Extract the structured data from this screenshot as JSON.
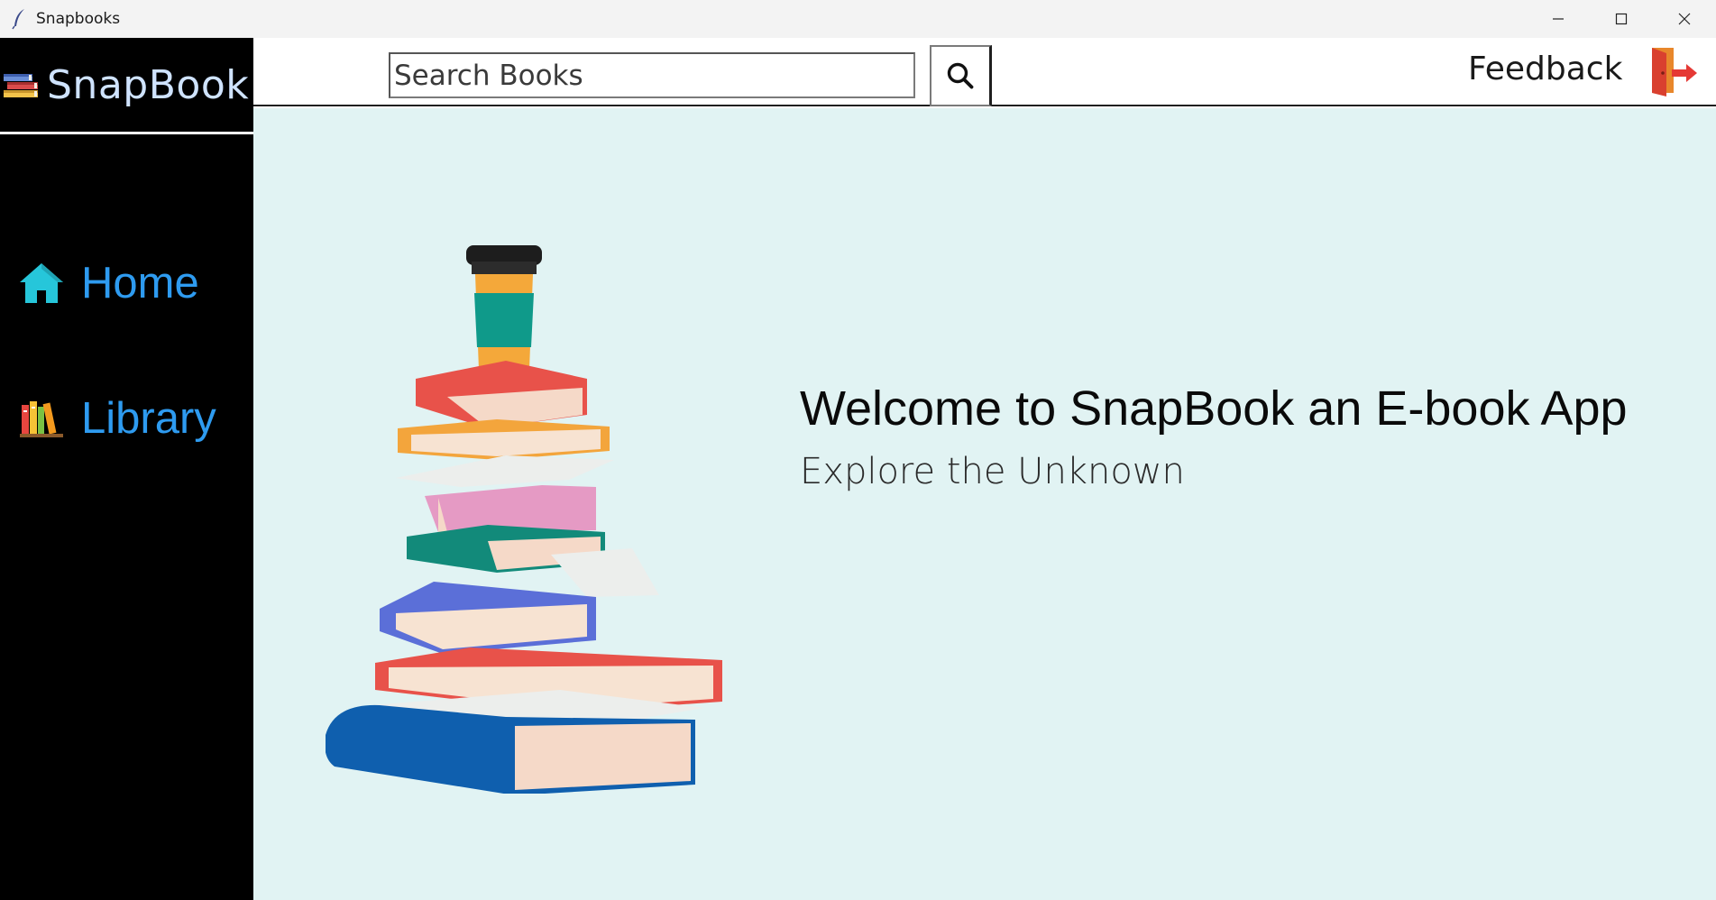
{
  "window": {
    "title": "Snapbooks",
    "app_icon": "feather-icon",
    "controls": [
      "minimize-icon",
      "maximize-icon",
      "close-icon"
    ]
  },
  "sidebar": {
    "brand": {
      "name": "SnapBook",
      "icon": "books-stack-icon"
    },
    "items": [
      {
        "label": "Home",
        "icon": "home-icon",
        "icon_color": "#26c6da"
      },
      {
        "label": "Library",
        "icon": "bookshelf-icon"
      }
    ],
    "label_color": "#2e9bf0",
    "background": "#000000"
  },
  "topbar": {
    "search": {
      "placeholder": "Search Books",
      "value": "",
      "icon": "search-icon"
    },
    "feedback_label": "Feedback",
    "logout_icon": "logout-door-icon"
  },
  "main": {
    "background": "#e1f3f3",
    "title": "Welcome to SnapBook an E-book App",
    "subtitle": "Explore the Unknown",
    "illustration": "stacked-books-with-coffee-cup"
  }
}
